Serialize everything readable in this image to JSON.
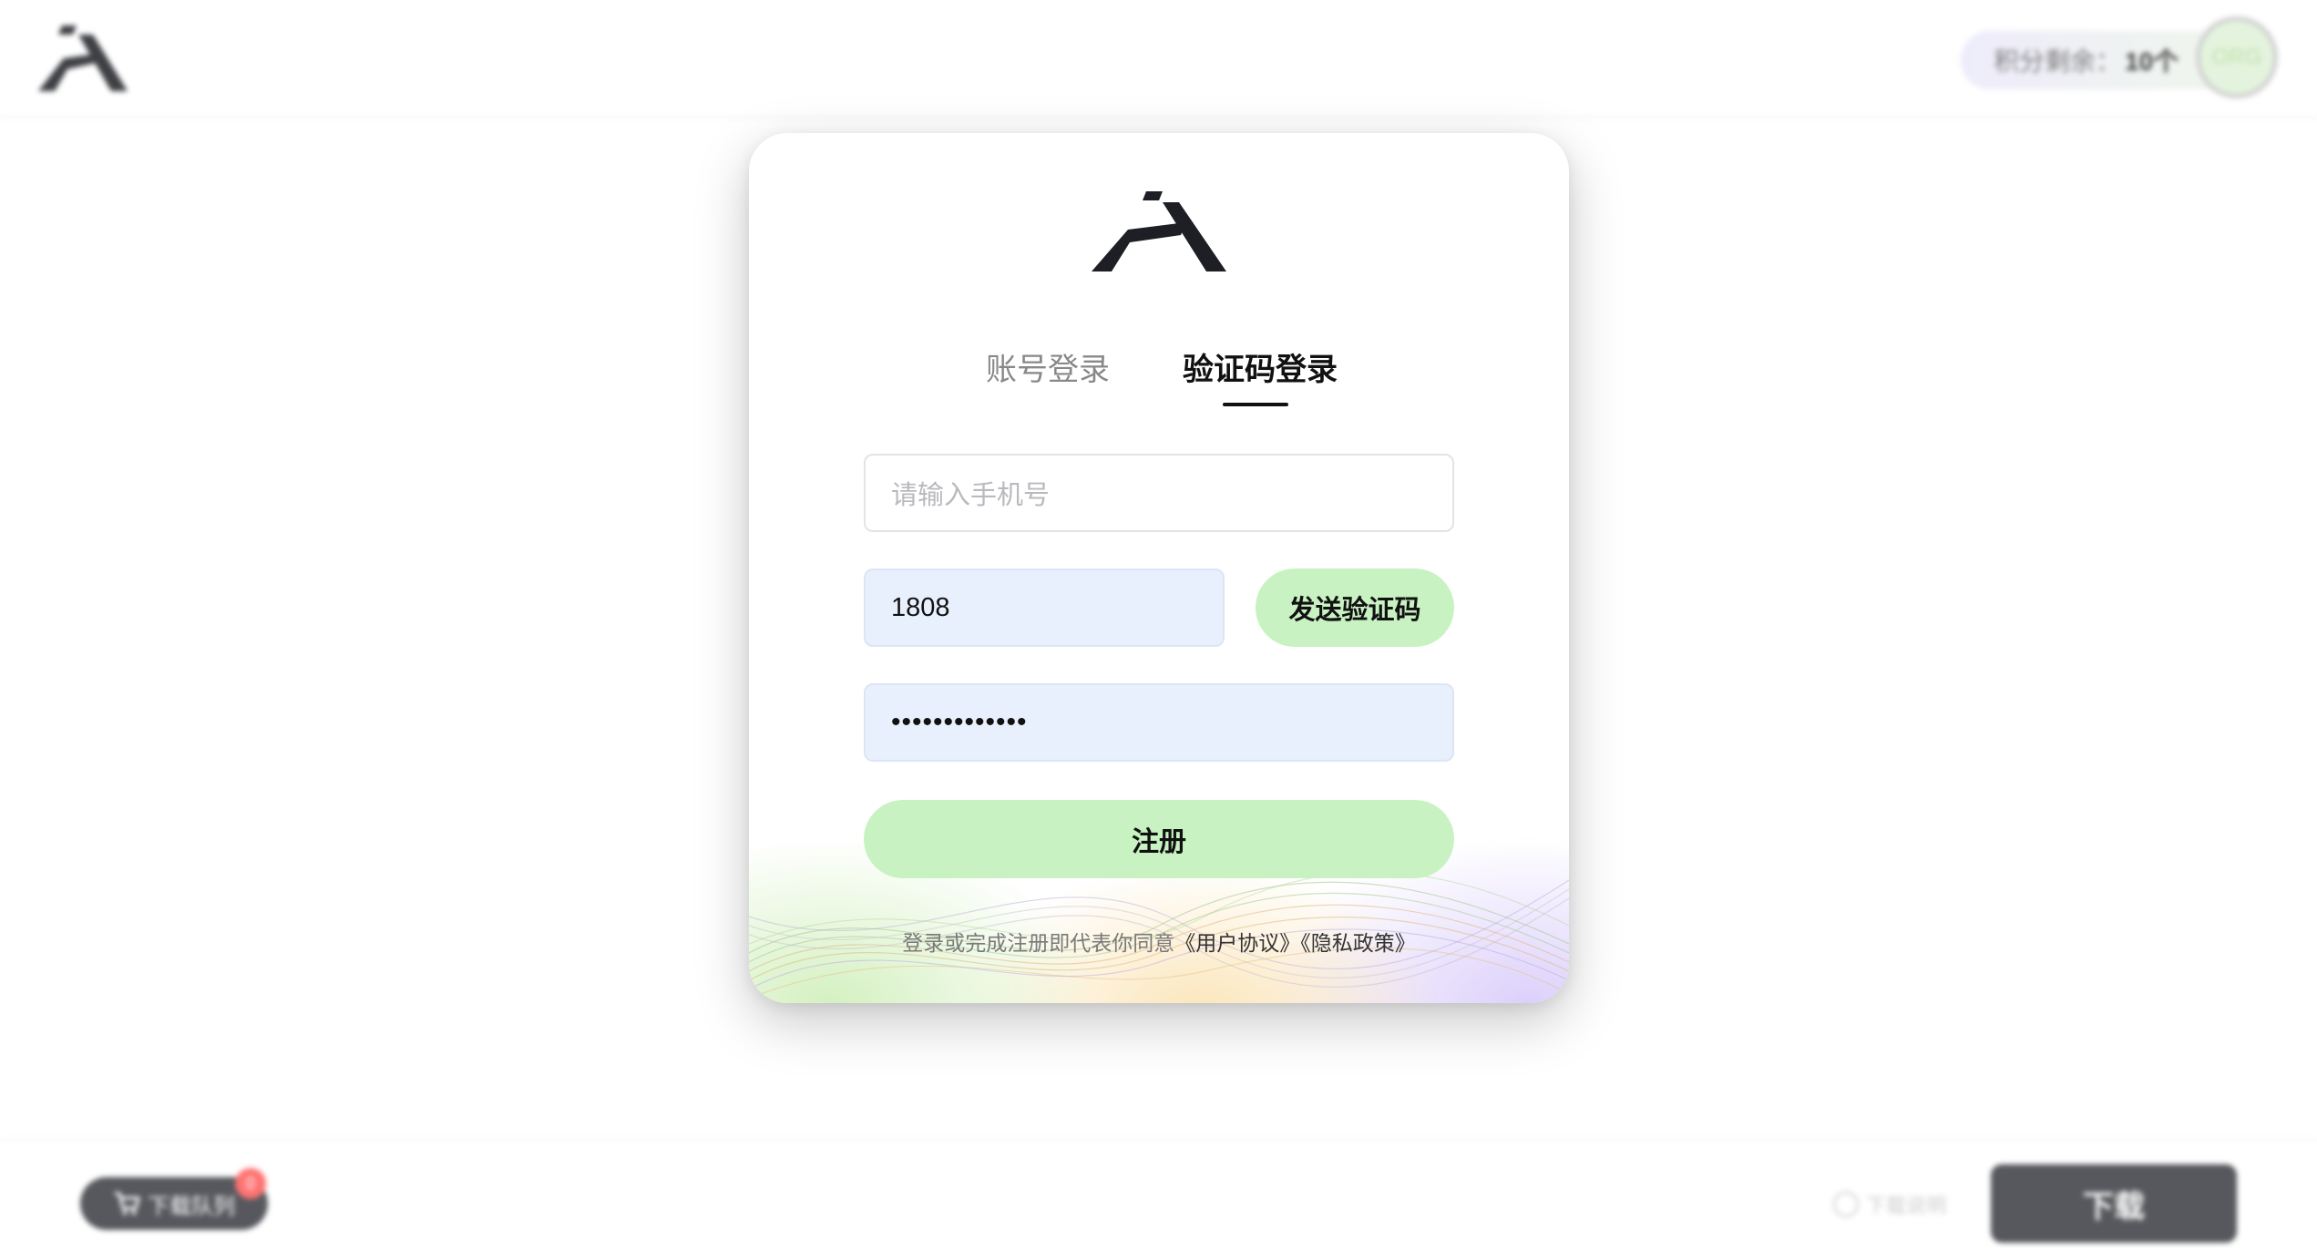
{
  "background": {
    "points": {
      "label": "积分剩余：",
      "value": "10个"
    },
    "avatar": {
      "text": "ORG"
    },
    "footer": {
      "queue_label": "下载队列",
      "queue_count": "0",
      "record_label": "下载说明",
      "download_label": "下载"
    }
  },
  "modal": {
    "tabs": [
      {
        "label": "账号登录",
        "active": false
      },
      {
        "label": "验证码登录",
        "active": true
      }
    ],
    "phone_placeholder": "请输入手机号",
    "code_value": "1808",
    "password_value": "•••••••••••••",
    "send_code_label": "发送验证码",
    "register_label": "注册",
    "agreement": {
      "prefix": "登录或完成注册即代表你同意",
      "user_agreement": "《用户协议》",
      "privacy_policy": "《隐私政策》"
    }
  },
  "colors": {
    "accent_green": "#c8f2c2",
    "input_fill": "#e8effd",
    "dark_button": "#3a3c42",
    "badge_red": "#ff5b5b"
  }
}
